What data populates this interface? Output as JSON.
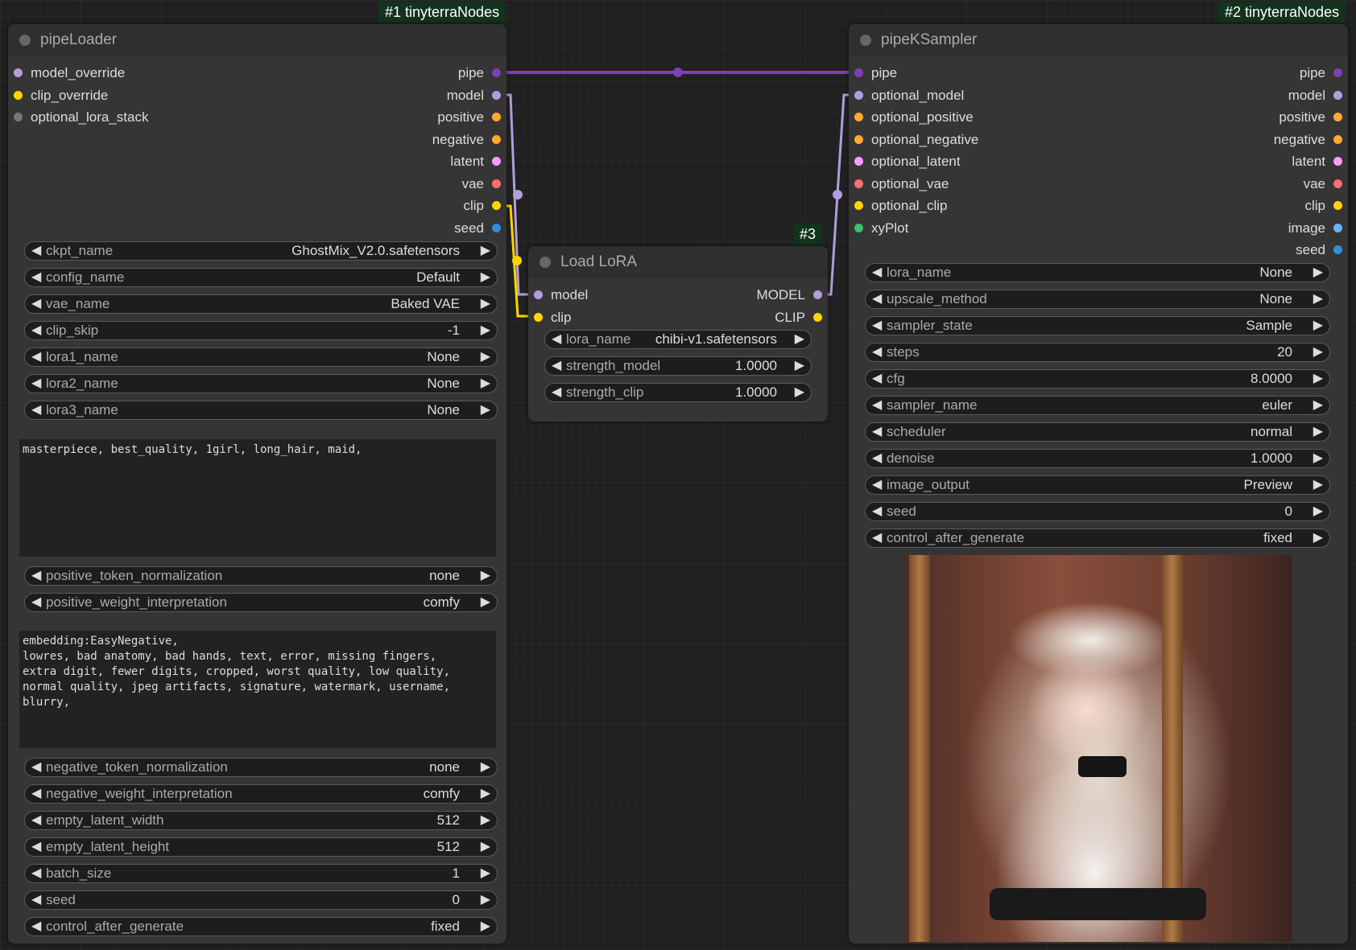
{
  "node1": {
    "badge": "#1 tinyterraNodes",
    "title": "pipeLoader",
    "inputs": [
      {
        "label": "model_override",
        "color": "#b39ddb"
      },
      {
        "label": "clip_override",
        "color": "#ffd500"
      },
      {
        "label": "optional_lora_stack",
        "color": "#777777"
      }
    ],
    "outputs": [
      {
        "label": "pipe",
        "color": "#7e3fb7"
      },
      {
        "label": "model",
        "color": "#b39ddb"
      },
      {
        "label": "positive",
        "color": "#ffa931"
      },
      {
        "label": "negative",
        "color": "#ffa931"
      },
      {
        "label": "latent",
        "color": "#ff9cf9"
      },
      {
        "label": "vae",
        "color": "#ff6e6e"
      },
      {
        "label": "clip",
        "color": "#ffd500"
      },
      {
        "label": "seed",
        "color": "#2f8fd9"
      }
    ],
    "widgets_a": [
      {
        "name": "ckpt_name",
        "value": "GhostMix_V2.0.safetensors"
      },
      {
        "name": "config_name",
        "value": "Default"
      },
      {
        "name": "vae_name",
        "value": "Baked VAE"
      },
      {
        "name": "clip_skip",
        "value": "-1"
      },
      {
        "name": "lora1_name",
        "value": "None"
      },
      {
        "name": "lora2_name",
        "value": "None"
      },
      {
        "name": "lora3_name",
        "value": "None"
      }
    ],
    "positive_text": "masterpiece, best_quality, 1girl, long_hair, maid,",
    "widgets_b": [
      {
        "name": "positive_token_normalization",
        "value": "none"
      },
      {
        "name": "positive_weight_interpretation",
        "value": "comfy"
      }
    ],
    "negative_text": "embedding:EasyNegative,\nlowres, bad anatomy, bad hands, text, error, missing fingers,\nextra digit, fewer digits, cropped, worst quality, low quality,\nnormal quality, jpeg artifacts, signature, watermark, username,\nblurry,",
    "widgets_c": [
      {
        "name": "negative_token_normalization",
        "value": "none"
      },
      {
        "name": "negative_weight_interpretation",
        "value": "comfy"
      },
      {
        "name": "empty_latent_width",
        "value": "512"
      },
      {
        "name": "empty_latent_height",
        "value": "512"
      },
      {
        "name": "batch_size",
        "value": "1"
      },
      {
        "name": "seed",
        "value": "0"
      },
      {
        "name": "control_after_generate",
        "value": "fixed"
      }
    ]
  },
  "node2": {
    "badge": "#2 tinyterraNodes",
    "title": "pipeKSampler",
    "inputs": [
      {
        "label": "pipe",
        "color": "#7e3fb7"
      },
      {
        "label": "optional_model",
        "color": "#b39ddb"
      },
      {
        "label": "optional_positive",
        "color": "#ffa931"
      },
      {
        "label": "optional_negative",
        "color": "#ffa931"
      },
      {
        "label": "optional_latent",
        "color": "#ff9cf9"
      },
      {
        "label": "optional_vae",
        "color": "#ff6e6e"
      },
      {
        "label": "optional_clip",
        "color": "#ffd500"
      },
      {
        "label": "xyPlot",
        "color": "#3ac06b"
      }
    ],
    "outputs": [
      {
        "label": "pipe",
        "color": "#7e3fb7"
      },
      {
        "label": "model",
        "color": "#b39ddb"
      },
      {
        "label": "positive",
        "color": "#ffa931"
      },
      {
        "label": "negative",
        "color": "#ffa931"
      },
      {
        "label": "latent",
        "color": "#ff9cf9"
      },
      {
        "label": "vae",
        "color": "#ff6e6e"
      },
      {
        "label": "clip",
        "color": "#ffd500"
      },
      {
        "label": "image",
        "color": "#64b5f6"
      },
      {
        "label": "seed",
        "color": "#2f8fd9"
      }
    ],
    "widgets": [
      {
        "name": "lora_name",
        "value": "None"
      },
      {
        "name": "upscale_method",
        "value": "None"
      },
      {
        "name": "sampler_state",
        "value": "Sample"
      },
      {
        "name": "steps",
        "value": "20"
      },
      {
        "name": "cfg",
        "value": "8.0000"
      },
      {
        "name": "sampler_name",
        "value": "euler"
      },
      {
        "name": "scheduler",
        "value": "normal"
      },
      {
        "name": "denoise",
        "value": "1.0000"
      },
      {
        "name": "image_output",
        "value": "Preview"
      },
      {
        "name": "seed",
        "value": "0"
      },
      {
        "name": "control_after_generate",
        "value": "fixed"
      }
    ]
  },
  "node3": {
    "badge": "#3",
    "title": "Load LoRA",
    "inputs": [
      {
        "label": "model",
        "color": "#b39ddb"
      },
      {
        "label": "clip",
        "color": "#ffd500"
      }
    ],
    "outputs": [
      {
        "label": "MODEL",
        "color": "#b39ddb"
      },
      {
        "label": "CLIP",
        "color": "#ffd500"
      }
    ],
    "widgets": [
      {
        "name": "lora_name",
        "value": "chibi-v1.safetensors"
      },
      {
        "name": "strength_model",
        "value": "1.0000"
      },
      {
        "name": "strength_clip",
        "value": "1.0000"
      }
    ]
  },
  "arrows": {
    "left": "◀",
    "right": "▶"
  },
  "colors": {
    "pipe_link": "#7e3fb7",
    "model_link": "#b39ddb",
    "clip_link": "#ffd500"
  }
}
